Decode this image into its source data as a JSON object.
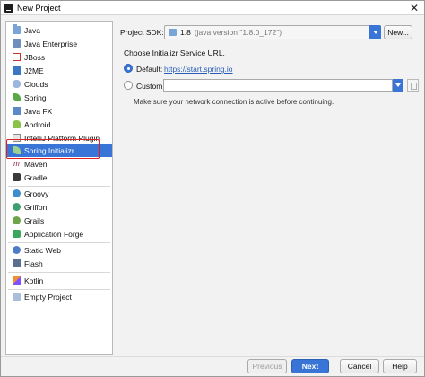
{
  "window": {
    "title": "New Project",
    "close_glyph": "✕"
  },
  "sidebar": {
    "items": [
      {
        "label": "Java",
        "icon": "folder-icon"
      },
      {
        "label": "Java Enterprise",
        "icon": "java-enterprise-icon"
      },
      {
        "label": "JBoss",
        "icon": "jboss-icon"
      },
      {
        "label": "J2ME",
        "icon": "j2me-icon"
      },
      {
        "label": "Clouds",
        "icon": "cloud-icon"
      },
      {
        "label": "Spring",
        "icon": "spring-leaf-icon"
      },
      {
        "label": "Java FX",
        "icon": "javafx-icon"
      },
      {
        "label": "Android",
        "icon": "android-icon"
      },
      {
        "label": "IntelliJ Platform Plugin",
        "icon": "plugin-icon"
      },
      {
        "label": "Spring Initializr",
        "icon": "spring-initializr-icon",
        "selected": true
      },
      {
        "label": "Maven",
        "icon": "maven-icon"
      },
      {
        "label": "Gradle",
        "icon": "gradle-icon"
      },
      {
        "label": "Groovy",
        "icon": "groovy-icon"
      },
      {
        "label": "Griffon",
        "icon": "griffon-icon"
      },
      {
        "label": "Grails",
        "icon": "grails-icon"
      },
      {
        "label": "Application Forge",
        "icon": "application-forge-icon"
      },
      {
        "label": "Static Web",
        "icon": "static-web-icon"
      },
      {
        "label": "Flash",
        "icon": "flash-icon"
      },
      {
        "label": "Kotlin",
        "icon": "kotlin-icon"
      },
      {
        "label": "Empty Project",
        "icon": "empty-project-icon"
      }
    ]
  },
  "main": {
    "sdk_label": "Project SDK:",
    "sdk_value": "1.8",
    "sdk_version": "(java version \"1.8.0_172\")",
    "new_button": "New...",
    "choose_label": "Choose Initializr Service URL.",
    "default_label": "Default:",
    "default_url": "https://start.spring.io",
    "custom_label": "Custom:",
    "custom_value": "",
    "network_note": "Make sure your network connection is active before continuing."
  },
  "footer": {
    "previous": "Previous",
    "next": "Next",
    "cancel": "Cancel",
    "help": "Help"
  },
  "colors": {
    "accent": "#3875d7",
    "highlight_border": "#e02020"
  }
}
